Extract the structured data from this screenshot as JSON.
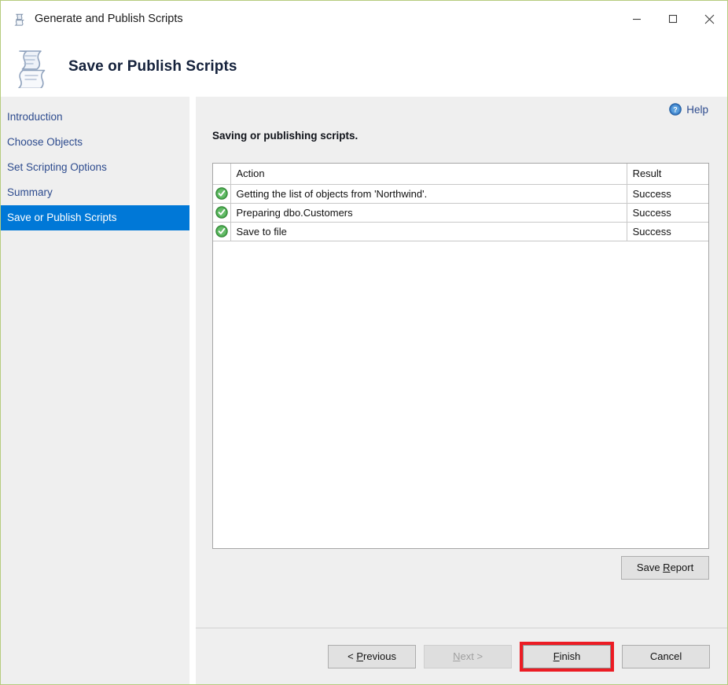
{
  "window": {
    "title": "Generate and Publish Scripts",
    "app_icon": "script-scroll-icon",
    "controls": {
      "minimize": "minimize-icon",
      "maximize": "maximize-icon",
      "close": "close-icon"
    }
  },
  "header": {
    "title": "Save or Publish Scripts",
    "icon": "script-scroll-icon"
  },
  "sidebar": {
    "items": [
      {
        "label": "Introduction",
        "selected": false
      },
      {
        "label": "Choose Objects",
        "selected": false
      },
      {
        "label": "Set Scripting Options",
        "selected": false
      },
      {
        "label": "Summary",
        "selected": false
      },
      {
        "label": "Save or Publish Scripts",
        "selected": true
      }
    ]
  },
  "content": {
    "help": {
      "label": "Help",
      "icon": "help-circle-icon"
    },
    "section_title": "Saving or publishing scripts.",
    "table": {
      "columns": [
        "",
        "Action",
        "Result"
      ],
      "rows": [
        {
          "status_icon": "success-check-icon",
          "action": "Getting the list of objects from 'Northwind'.",
          "result": "Success"
        },
        {
          "status_icon": "success-check-icon",
          "action": "Preparing dbo.Customers",
          "result": "Success"
        },
        {
          "status_icon": "success-check-icon",
          "action": "Save to file",
          "result": "Success"
        }
      ]
    },
    "save_report_button": {
      "prefix": "Save ",
      "accel": "R",
      "suffix": "eport"
    }
  },
  "footer": {
    "previous": {
      "prefix": "< ",
      "accel": "P",
      "suffix": "revious"
    },
    "next": {
      "accel": "N",
      "suffix": "ext >"
    },
    "finish": {
      "accel": "F",
      "suffix": "inish"
    },
    "cancel": {
      "label": "Cancel"
    }
  },
  "colors": {
    "window_border": "#b6cc7e",
    "selection_blue": "#0078d7",
    "link_blue": "#2d4b8e",
    "success_green": "#3ca03c",
    "highlight_red": "#ec1c24",
    "pane_background": "#efefef"
  }
}
